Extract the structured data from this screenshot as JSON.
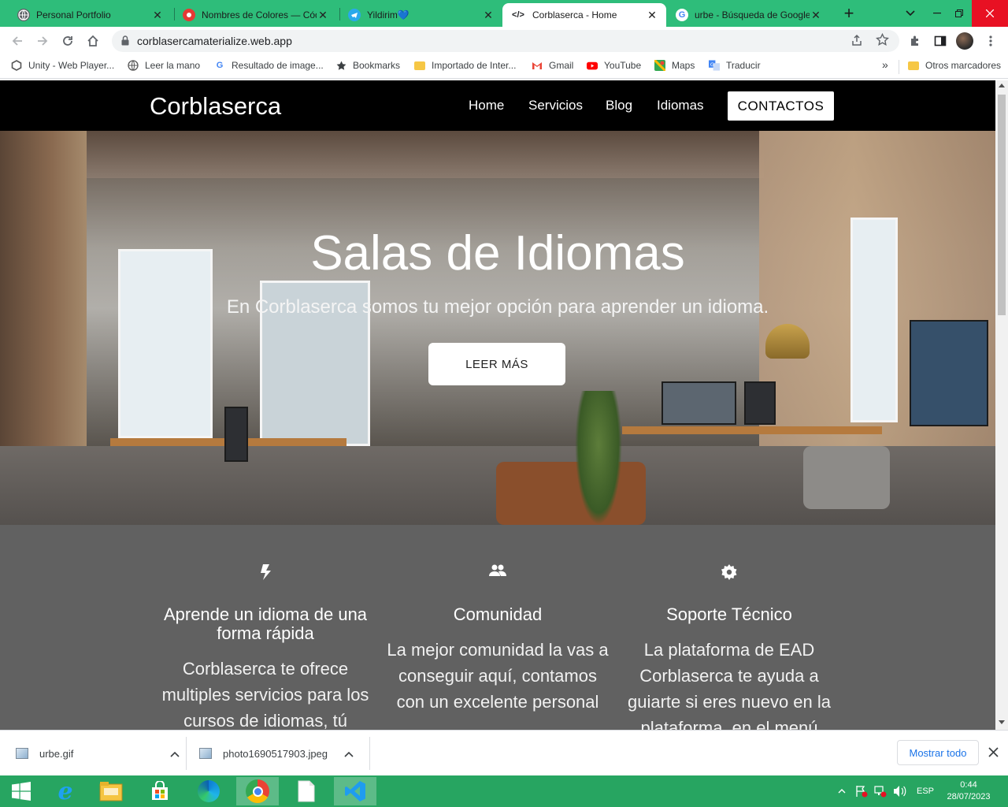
{
  "browser": {
    "tabs": [
      {
        "title": "Personal Portfolio",
        "icon": "globe-icon"
      },
      {
        "title": "Nombres de Colores — Cód",
        "icon": "record-icon"
      },
      {
        "title": "Yildirim💙",
        "icon": "telegram-icon"
      },
      {
        "title": "Corblaserca - Home",
        "icon": "code-icon",
        "active": true
      },
      {
        "title": "urbe - Búsqueda de Google",
        "icon": "google-icon"
      }
    ],
    "url": "corblasercamaterialize.web.app",
    "bookmarks": [
      {
        "label": "Unity - Web Player...",
        "icon": "unity-icon"
      },
      {
        "label": "Leer la mano",
        "icon": "globe-icon"
      },
      {
        "label": "Resultado de image...",
        "icon": "google-icon"
      },
      {
        "label": "Bookmarks",
        "icon": "star-icon"
      },
      {
        "label": "Importado de Inter...",
        "icon": "folder-icon"
      },
      {
        "label": "Gmail",
        "icon": "gmail-icon"
      },
      {
        "label": "YouTube",
        "icon": "youtube-icon"
      },
      {
        "label": "Maps",
        "icon": "maps-icon"
      },
      {
        "label": "Traducir",
        "icon": "translate-icon"
      }
    ],
    "bookmarks_more": "»",
    "other_bookmarks": "Otros marcadores"
  },
  "site": {
    "brand": "Corblaserca",
    "nav": {
      "home": "Home",
      "services": "Servicios",
      "blog": "Blog",
      "languages": "Idiomas",
      "contact": "CONTACTOS"
    },
    "hero": {
      "title": "Salas de Idiomas",
      "subtitle": "En Corblaserca somos tu mejor opción para aprender un idioma.",
      "button": "LEER MÁS"
    },
    "features": [
      {
        "icon": "flash-icon",
        "title": "Aprende un idioma de una forma rápida",
        "text": "Corblaserca te ofrece multiples servicios para los cursos de idiomas, tú"
      },
      {
        "icon": "group-icon",
        "title": "Comunidad",
        "text": "La mejor comunidad la vas a conseguir aquí, contamos con un excelente personal"
      },
      {
        "icon": "settings-icon",
        "title": "Soporte Técnico",
        "text": "La plataforma de EAD Corblaserca te ayuda a guiarte si eres nuevo en la plataforma, en el menú"
      }
    ],
    "colors": {
      "navbar": "#000000",
      "features_bg": "#616161"
    }
  },
  "downloads": {
    "items": [
      {
        "name": "urbe.gif"
      },
      {
        "name": "photo1690517903.jpeg"
      }
    ],
    "show_all": "Mostrar todo"
  },
  "taskbar": {
    "language": "ESP",
    "time": "0:44",
    "date": "28/07/2023",
    "colors": {
      "bar": "#27a561"
    }
  }
}
